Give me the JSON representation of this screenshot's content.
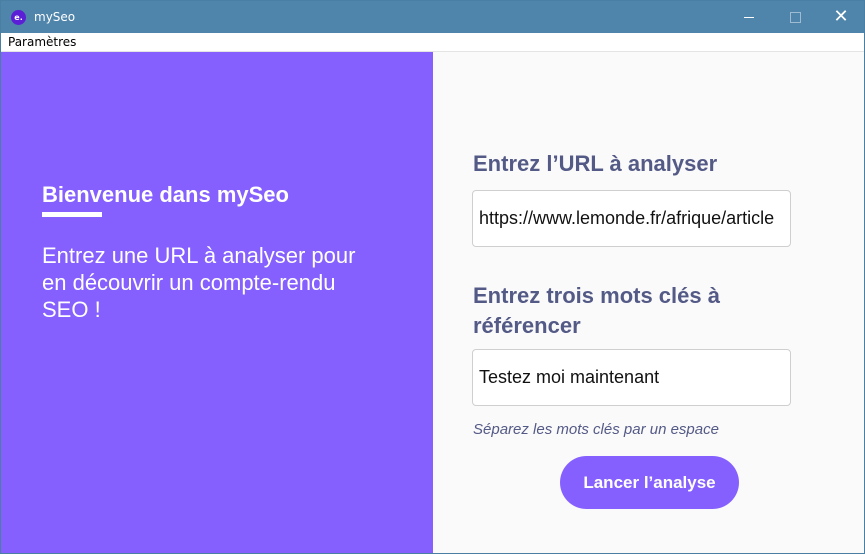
{
  "window": {
    "title": "mySeo",
    "icon_glyph": "e.",
    "close_glyph": "✕"
  },
  "menu": {
    "items": [
      {
        "label": "Paramètres"
      }
    ]
  },
  "welcome": {
    "title": "Bienvenue dans mySeo",
    "text": "Entrez une URL à analyser pour en découvrir un compte-rendu SEO !"
  },
  "form": {
    "url_label": "Entrez l’URL à analyser",
    "url_value": "https://www.lemonde.fr/afrique/article",
    "keywords_label": "Entrez trois mots clés à référencer",
    "keywords_value": "Testez moi maintenant",
    "keywords_hint": "Séparez les mots clés par un espace",
    "submit_label": "Lancer l’analyse"
  },
  "colors": {
    "titlebar": "#4f84ab",
    "accent": "#8560fe",
    "label": "#545a86"
  }
}
